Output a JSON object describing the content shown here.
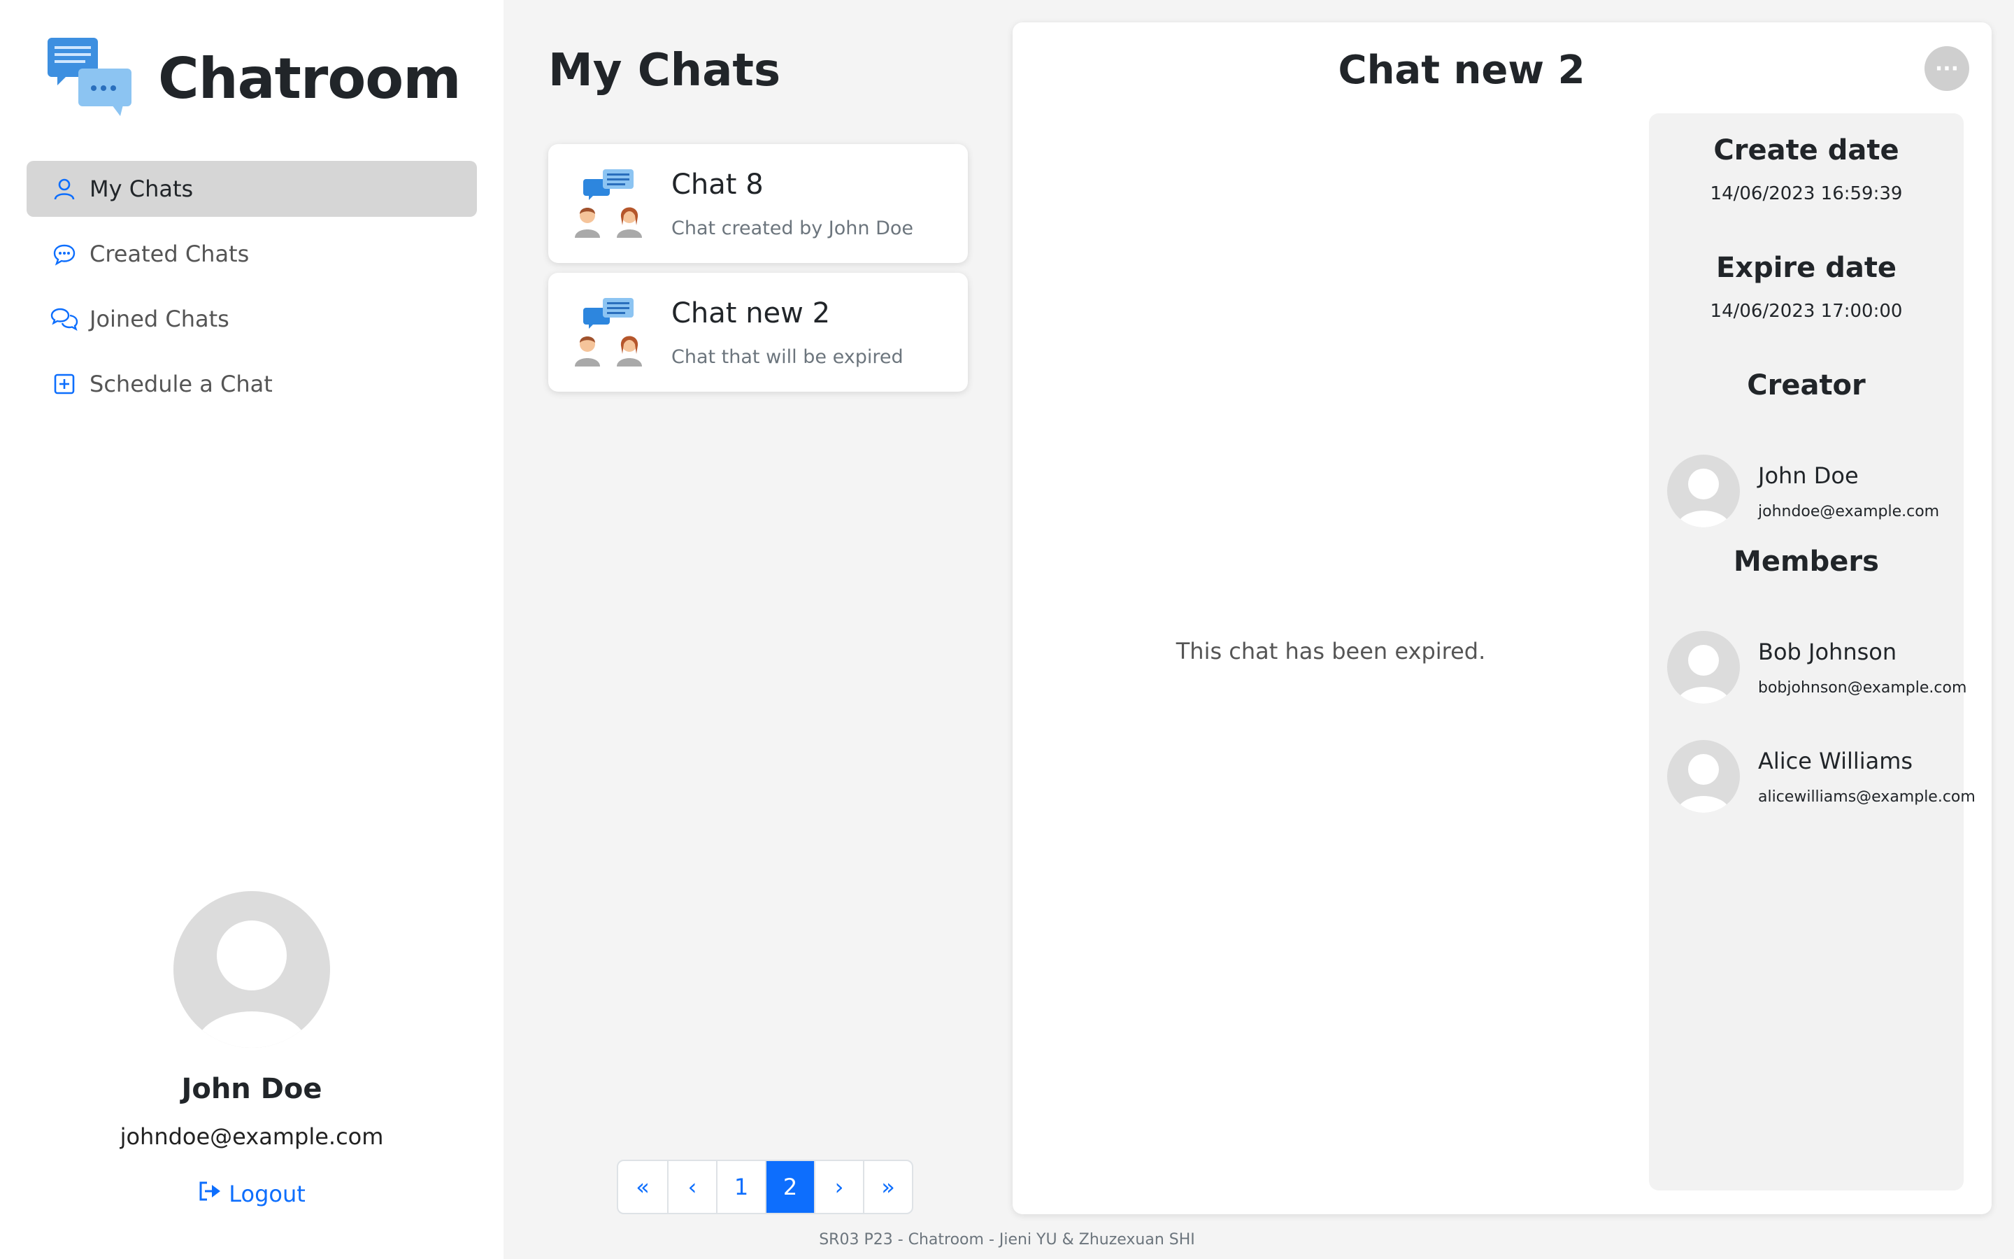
{
  "app": {
    "title": "Chatroom"
  },
  "sidebar": {
    "items": [
      {
        "label": "My Chats",
        "icon": "person-icon",
        "active": true
      },
      {
        "label": "Created Chats",
        "icon": "chat-dots-icon",
        "active": false
      },
      {
        "label": "Joined Chats",
        "icon": "chats-icon",
        "active": false
      },
      {
        "label": "Schedule a Chat",
        "icon": "plus-square-icon",
        "active": false
      }
    ],
    "profile": {
      "name": "John Doe",
      "email": "johndoe@example.com",
      "logout_label": "Logout"
    }
  },
  "list": {
    "title": "My Chats",
    "chats": [
      {
        "title": "Chat 8",
        "description": "Chat created by John Doe"
      },
      {
        "title": "Chat new 2",
        "description": "Chat that will be expired"
      }
    ],
    "pagination": {
      "first": "«",
      "prev": "‹",
      "pages": [
        "1",
        "2"
      ],
      "current": "2",
      "next": "›",
      "last": "»"
    }
  },
  "detail": {
    "title": "Chat new 2",
    "more_label": "···",
    "message": "This chat has been expired.",
    "create_date_label": "Create date",
    "create_date": "14/06/2023 16:59:39",
    "expire_date_label": "Expire date",
    "expire_date": "14/06/2023 17:00:00",
    "creator_label": "Creator",
    "creator": {
      "name": "John Doe",
      "email": "johndoe@example.com"
    },
    "members_label": "Members",
    "members": [
      {
        "name": "Bob Johnson",
        "email": "bobjohnson@example.com"
      },
      {
        "name": "Alice Williams",
        "email": "alicewilliams@example.com"
      }
    ]
  },
  "footer": "SR03 P23 - Chatroom - Jieni YU & Zhuzexuan SHI",
  "colors": {
    "accent": "#0d6efd",
    "active_nav": "#d6d6d6",
    "background": "#f4f4f4"
  }
}
